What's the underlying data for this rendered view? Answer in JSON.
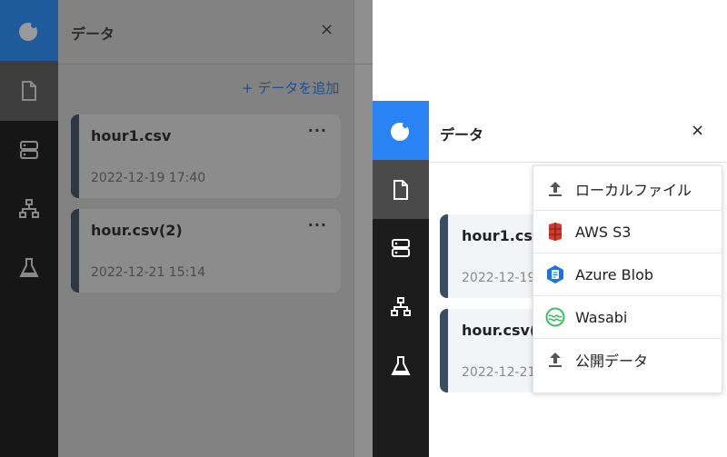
{
  "left_panel": {
    "title": "データ",
    "close": "×",
    "add_data": "+ データを追加",
    "files": [
      {
        "name": "hour1.csv",
        "date": "2022-12-19 17:40",
        "menu": "···"
      },
      {
        "name": "hour.csv(2)",
        "date": "2022-12-21 15:14",
        "menu": "···"
      }
    ]
  },
  "right_panel": {
    "title": "データ",
    "close": "×",
    "files": [
      {
        "name": "hour1.csv",
        "date": "2022-12-19"
      },
      {
        "name": "hour.csv(",
        "date": "2022-12-21"
      }
    ],
    "menu": [
      {
        "label": "ローカルファイル",
        "icon": "upload-icon"
      },
      {
        "label": "AWS S3",
        "icon": "aws-s3-icon"
      },
      {
        "label": "Azure Blob",
        "icon": "azure-blob-icon"
      },
      {
        "label": "Wasabi",
        "icon": "wasabi-icon"
      },
      {
        "label": "公開データ",
        "icon": "upload-icon"
      }
    ]
  },
  "colors": {
    "accent_blue": "#2a83f2",
    "rail": "#1c1c1c",
    "card_bar": "#3b4d60",
    "aws_red": "#d13a2c",
    "azure_blue": "#1a73e8",
    "wasabi_green": "#3bbf5e"
  },
  "nav_icons": [
    "logo-icon",
    "document-icon",
    "database-icon",
    "network-icon",
    "flask-icon"
  ]
}
